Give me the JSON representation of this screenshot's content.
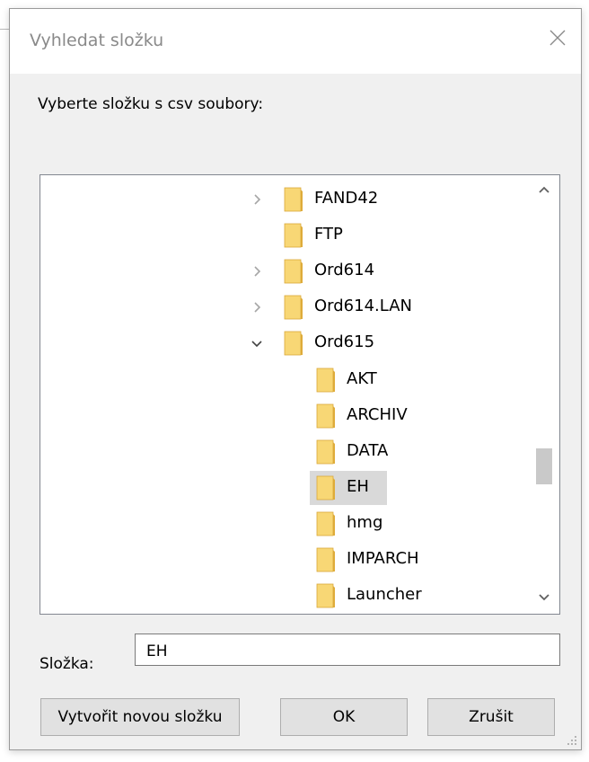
{
  "window": {
    "title": "Vyhledat složku",
    "close_icon": "close-icon"
  },
  "instruction": "Vyberte složku s csv soubory:",
  "tree": {
    "items": [
      {
        "label": "FAND42",
        "level": 0,
        "expander": "collapsed",
        "selected": false
      },
      {
        "label": "FTP",
        "level": 0,
        "expander": "none",
        "selected": false
      },
      {
        "label": "Ord614",
        "level": 0,
        "expander": "collapsed",
        "selected": false
      },
      {
        "label": "Ord614.LAN",
        "level": 0,
        "expander": "collapsed",
        "selected": false
      },
      {
        "label": "Ord615",
        "level": 0,
        "expander": "expanded",
        "selected": false
      },
      {
        "label": "AKT",
        "level": 1,
        "expander": "none",
        "selected": false
      },
      {
        "label": "ARCHIV",
        "level": 1,
        "expander": "none",
        "selected": false
      },
      {
        "label": "DATA",
        "level": 1,
        "expander": "none",
        "selected": false
      },
      {
        "label": "EH",
        "level": 1,
        "expander": "none",
        "selected": true
      },
      {
        "label": "hmg",
        "level": 1,
        "expander": "none",
        "selected": false
      },
      {
        "label": "IMPARCH",
        "level": 1,
        "expander": "none",
        "selected": false
      },
      {
        "label": "Launcher",
        "level": 1,
        "expander": "none",
        "selected": false
      }
    ],
    "folder_color": "#f8d775",
    "folder_back_color": "#e0ad3a",
    "selection_color": "#d9d9d9"
  },
  "folder_field": {
    "label": "Složka:",
    "value": "EH"
  },
  "buttons": {
    "new_folder": "Vytvořit novou složku",
    "ok": "OK",
    "cancel": "Zrušit"
  }
}
